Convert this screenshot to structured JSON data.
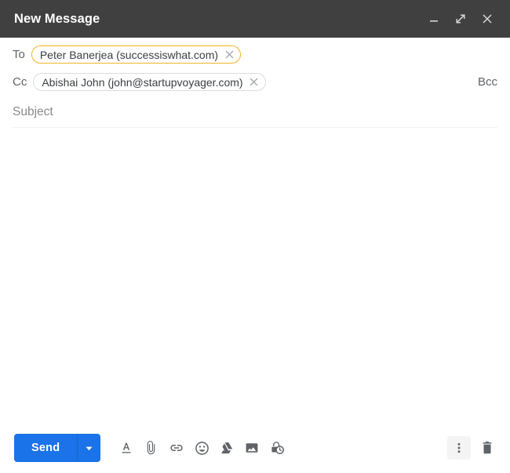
{
  "window": {
    "title": "New Message",
    "controls": [
      {
        "name": "minimize",
        "icon": "minimize-icon"
      },
      {
        "name": "expand",
        "icon": "expand-icon"
      },
      {
        "name": "close",
        "icon": "close-icon"
      }
    ]
  },
  "fields": {
    "to": {
      "label": "To",
      "chip": "Peter Banerjea (successiswhat.com)",
      "chip_border_color": "#f0b429"
    },
    "cc": {
      "label": "Cc",
      "chip": "Abishai John (john@startupvoyager.com)",
      "chip_border_color": "#dadce0"
    },
    "bcc": {
      "label": "Bcc"
    },
    "subject": {
      "placeholder": "Subject",
      "value": ""
    },
    "body": {
      "value": ""
    }
  },
  "toolbar": {
    "send_label": "Send",
    "send_color": "#1a73e8",
    "send_dropdown": "send-options-caret",
    "tools": [
      {
        "name": "formatting-options",
        "icon": "format-text-icon"
      },
      {
        "name": "attach-files",
        "icon": "paperclip-icon"
      },
      {
        "name": "insert-link",
        "icon": "link-icon"
      },
      {
        "name": "insert-emoji",
        "icon": "emoji-icon"
      },
      {
        "name": "insert-drive-file",
        "icon": "google-drive-icon"
      },
      {
        "name": "insert-photo",
        "icon": "image-icon"
      },
      {
        "name": "confidential-mode",
        "icon": "lock-clock-icon"
      }
    ],
    "more_options": "more-options-icon",
    "discard": "trash-icon"
  }
}
